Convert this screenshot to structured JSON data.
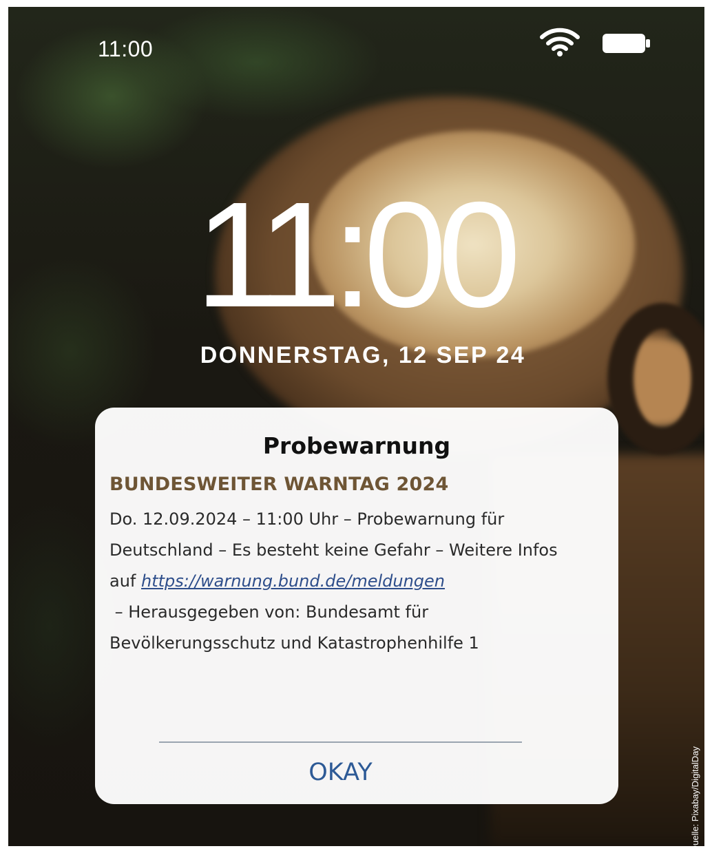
{
  "status_bar": {
    "time": "11:00",
    "wifi_icon": "wifi-icon",
    "battery_icon": "battery-icon"
  },
  "lock_screen": {
    "clock": "11:00",
    "date": "DONNERSTAG, 12 SEP 24"
  },
  "alert": {
    "title": "Probewarnung",
    "headline": "BUNDESWEITER WARNTAG 2024",
    "body_line_1": "Do. 12.09.2024 – 11:00 Uhr – Probewarnung für",
    "body_line_2": "Deutschland – Es besteht keine Gefahr – Weitere Infos",
    "body_line_3_prefix": "auf ",
    "link": "https://warnung.bund.de/meldungen",
    "body_line_4": " – Herausgegeben von: Bundesamt für",
    "body_line_5": "Bevölkerungsschutz und Katastrophenhilfe 1",
    "okay_label": "OKAY"
  },
  "credit": "Quelle: Pixabay/DigitalDay",
  "colors": {
    "headline": "#6e5535",
    "link": "#2d4d8a",
    "button": "#2d5a96"
  }
}
